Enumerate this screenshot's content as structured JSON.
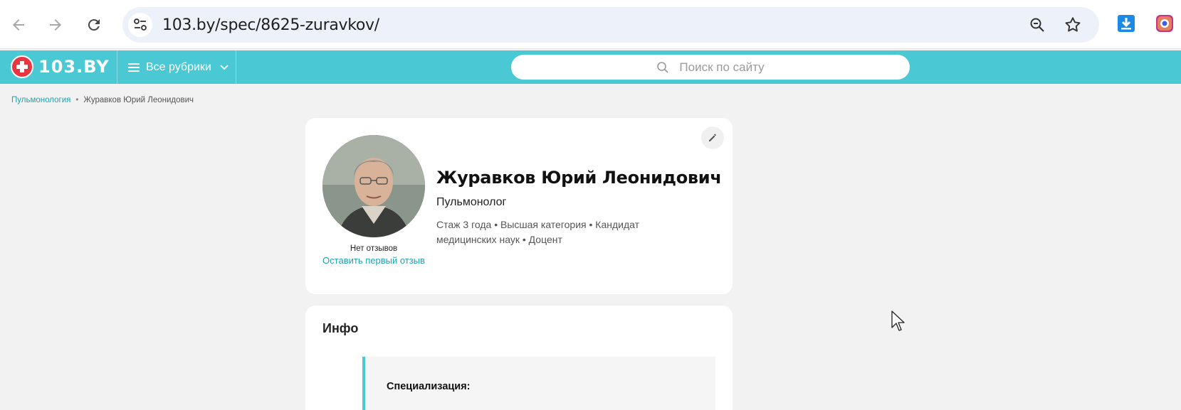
{
  "browser": {
    "url": "103.by/spec/8625-zuravkov/",
    "icons": [
      "back-arrow-icon",
      "forward-arrow-icon",
      "reload-icon",
      "site-settings-icon",
      "zoom-icon",
      "star-icon",
      "download-icon",
      "extension-icon"
    ]
  },
  "site": {
    "logo_text": "103.BY",
    "rubrics_label": "Все рубрики",
    "search_placeholder": "Поиск по сайту",
    "header_color": "#4ac8d4"
  },
  "breadcrumb": {
    "items": [
      "Пульмонология",
      "Журавков Юрий Леонидович"
    ]
  },
  "profile": {
    "name": "Журавков Юрий Леонидович",
    "specialty": "Пульмонолог",
    "meta": "Стаж 3 года  •  Высшая категория • Кандидат медицинских наук • Доцент",
    "reviews_none": "Нет отзывов",
    "leave_review": "Оставить первый отзыв"
  },
  "info": {
    "title": "Инфо",
    "specialization_label": "Специализация:"
  }
}
